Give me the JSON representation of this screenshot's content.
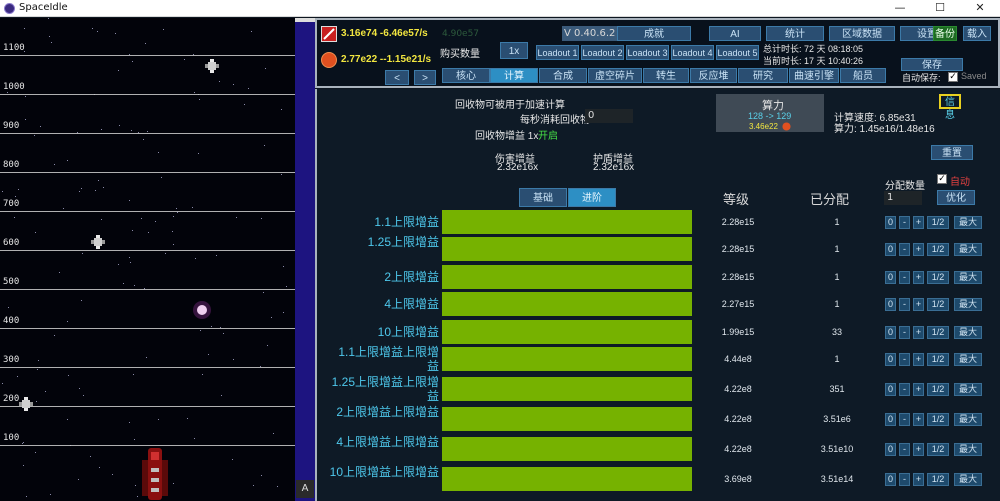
{
  "window": {
    "title": "SpaceIdle",
    "minimize": "—",
    "maximize": "☐",
    "close": "✕"
  },
  "game": {
    "height_labels": [
      "1100",
      "1000",
      "900",
      "800",
      "700",
      "600",
      "500",
      "400",
      "300",
      "200",
      "100"
    ],
    "scroll_button": "A"
  },
  "header": {
    "resource1": "3.16e74 -6.46e57/s",
    "resource1_ghost": "4.90e57",
    "resource2": "2.77e22 --1.15e21/s",
    "resource2_ghost": "",
    "buy_amount_label": "购买数量",
    "buy_multiplier": "1x",
    "version": "V 0.40.6.2",
    "nav_top": [
      "成就",
      "AI",
      "统计",
      "区域数据",
      "设置"
    ],
    "backup": "备份",
    "load": "载入",
    "loadouts": [
      "Loadout 1",
      "Loadout 2",
      "Loadout 3",
      "Loadout 4",
      "Loadout 5"
    ],
    "total_time": "总计时长: 72 天 08:18:05",
    "current_time": "当前时长: 17 天 10:40:26",
    "save": "保存",
    "autosave_label": "自动保存:",
    "saved": "Saved",
    "prev": "<",
    "next": ">",
    "tabs": [
      "核心",
      "计算",
      "合成",
      "虚空碎片",
      "转生",
      "反应堆",
      "研究",
      "曲速引擎",
      "船员"
    ],
    "active_tab": "计算"
  },
  "compute": {
    "recycle_info": "回收物可被用于加速计算",
    "recycle_per_sec_label": "每秒消耗回收物",
    "recycle_per_sec_value": "0",
    "recycle_bonus_label": "回收物增益 1x",
    "recycle_bonus_state": "开启",
    "damage_label": "伤害增益",
    "damage_value": "2.32e16x",
    "shield_label": "护盾增益",
    "shield_value": "2.32e16x",
    "power_title": "算力",
    "power_range": "128 -> 129",
    "power_cost": "3.46e22",
    "speed": "计算速度: 6.85e31",
    "power_total": "算力: 1.45e16/1.48e16",
    "info": "信息",
    "reset": "重置",
    "auto_label": "自动",
    "alloc_label": "分配数量",
    "alloc_value": "1",
    "optimize": "优化",
    "subtab_basic": "基础",
    "subtab_advanced": "进阶",
    "col_level": "等级",
    "col_allocated": "已分配",
    "row_buttons": [
      "0",
      "-",
      "+",
      "1/2",
      "最大"
    ],
    "rows": [
      {
        "label": "1.1上限增益",
        "level": "2.28e15",
        "allocated": "1",
        "fill": 1.0
      },
      {
        "label": "1.25上限增益",
        "level": "2.28e15",
        "allocated": "1",
        "fill": 1.0
      },
      {
        "label": "2上限增益",
        "level": "2.28e15",
        "allocated": "1",
        "fill": 1.0
      },
      {
        "label": "4上限增益",
        "level": "2.27e15",
        "allocated": "1",
        "fill": 1.0
      },
      {
        "label": "10上限增益",
        "level": "1.99e15",
        "allocated": "33",
        "fill": 1.0
      },
      {
        "label": "1.1上限增益上限增益",
        "level": "4.44e8",
        "allocated": "1",
        "fill": 1.0
      },
      {
        "label": "1.25上限增益上限增益",
        "level": "4.22e8",
        "allocated": "351",
        "fill": 1.0
      },
      {
        "label": "2上限增益上限增益",
        "level": "4.22e8",
        "allocated": "3.51e6",
        "fill": 1.0
      },
      {
        "label": "4上限增益上限增益",
        "level": "4.22e8",
        "allocated": "3.51e10",
        "fill": 1.0
      },
      {
        "label": "10上限增益上限增益",
        "level": "3.69e8",
        "allocated": "3.51e14",
        "fill": 1.0
      }
    ]
  }
}
